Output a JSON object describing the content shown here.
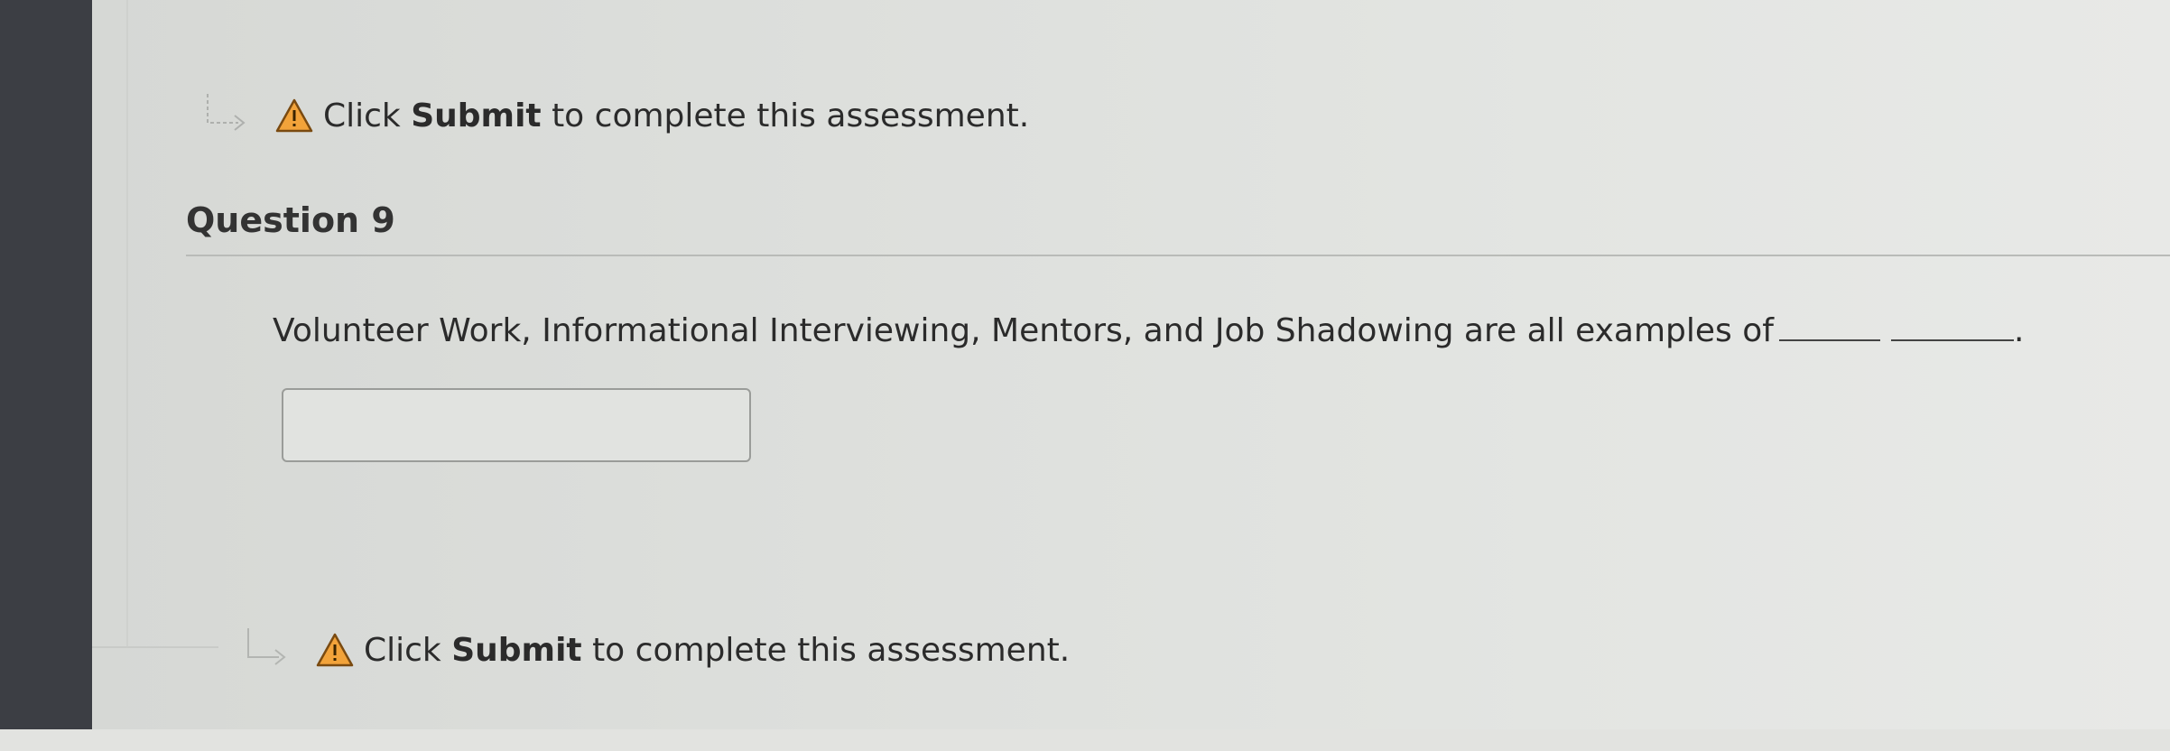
{
  "notice_top": {
    "prefix": "Click ",
    "bold": "Submit",
    "suffix": " to complete this assessment."
  },
  "question": {
    "title": "Question 9",
    "text": "Volunteer Work, Informational Interviewing, Mentors, and Job Shadowing are all examples of",
    "end_punct": ".",
    "answer_value": ""
  },
  "notice_bottom": {
    "prefix": "Click ",
    "bold": "Submit",
    "suffix": " to complete this assessment."
  },
  "colors": {
    "warning_fill": "#f2a33a",
    "warning_outline": "#7a4a10",
    "sidebar": "#3c3e44"
  },
  "icons": {
    "flow_arrow": "flow-arrow-icon",
    "warning": "warning-icon"
  }
}
